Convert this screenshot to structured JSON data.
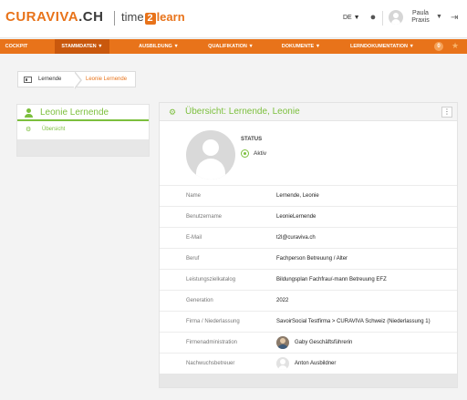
{
  "header": {
    "logo_main": "CURAVIVA",
    "logo_suffix": ".CH",
    "app_prefix": "time",
    "app_number": "2",
    "app_suffix": "learn",
    "language": "DE ▼",
    "user_first": "Paula",
    "user_last": "Praxis"
  },
  "nav": {
    "items": [
      {
        "label": "COCKPIT"
      },
      {
        "label": "STAMMDATEN ▼"
      },
      {
        "label": "AUSBILDUNG ▼"
      },
      {
        "label": "QUALIFIKATION ▼"
      },
      {
        "label": "DOKUMENTE ▼"
      },
      {
        "label": "LERNDOKUMENTATION ▼"
      }
    ],
    "badge": "0",
    "active_color": "#c9580d"
  },
  "breadcrumb": {
    "items": [
      "Lernende",
      "Leonie Lernende"
    ]
  },
  "sidebar": {
    "title": "Leonie Lernende",
    "items": [
      {
        "label": "Übersicht"
      }
    ]
  },
  "main": {
    "title": "Übersicht: Lernende, Leonie",
    "status_label": "STATUS",
    "status_value": "Aktiv",
    "fields": [
      {
        "label": "Name",
        "value": "Lernende, Leonie"
      },
      {
        "label": "Benutzername",
        "value": "LeonieLernende"
      },
      {
        "label": "E-Mail",
        "value": "t2l@curaviva.ch"
      },
      {
        "label": "Beruf",
        "value": "Fachperson Betreuung / Alter"
      },
      {
        "label": "Leistungszielkatalog",
        "value": "Bildungsplan Fachfrau/-mann Betreuung EFZ"
      },
      {
        "label": "Generation",
        "value": "2022"
      },
      {
        "label": "Firma / Niederlassung",
        "value": "SavoirSocial Testfirma > CURAVIVA Schweiz (Niederlassung 1)"
      },
      {
        "label": "Firmenadministration",
        "value": "Gaby Geschäftsführerin"
      },
      {
        "label": "Nachwuchsbetreuer",
        "value": "Anton Ausbildner"
      }
    ]
  },
  "colors": {
    "brand_orange": "#e8731a",
    "accent_green": "#7cbf3d"
  }
}
